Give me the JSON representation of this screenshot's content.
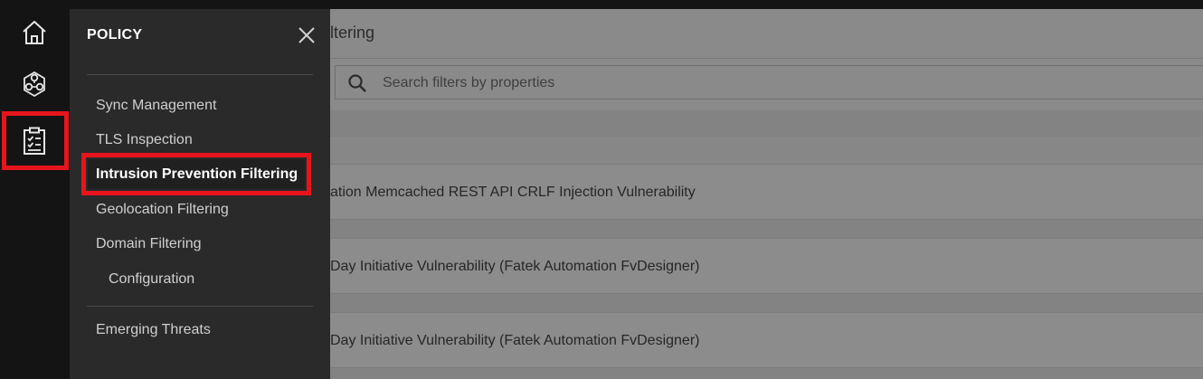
{
  "rail": {
    "items": [
      {
        "icon": "home-icon"
      },
      {
        "icon": "network-icon"
      },
      {
        "icon": "policy-clipboard-icon",
        "highlighted": true
      }
    ]
  },
  "flyout": {
    "title": "POLICY",
    "close_icon": "close-icon",
    "items": [
      {
        "label": "Sync Management"
      },
      {
        "label": "TLS Inspection"
      },
      {
        "label": "Intrusion Prevention Filtering",
        "active": true
      },
      {
        "label": "Geolocation Filtering"
      },
      {
        "label": "Domain Filtering"
      },
      {
        "label": "Configuration"
      },
      {
        "label": "Emerging Threats"
      }
    ]
  },
  "main": {
    "title": "ltering",
    "search": {
      "placeholder": "Search filters by properties",
      "value": ""
    },
    "filters": [
      {
        "name": "ation Memcached REST API CRLF Injection Vulnerability"
      },
      {
        "name": "Day Initiative Vulnerability (Fatek Automation FvDesigner)"
      },
      {
        "name": "Day Initiative Vulnerability (Fatek Automation FvDesigner)"
      }
    ]
  },
  "colors": {
    "highlight": "#e8141c",
    "flyout_bg": "#2a2a2a",
    "rail_bg": "#141414",
    "overlay": "#8a8a8a"
  }
}
